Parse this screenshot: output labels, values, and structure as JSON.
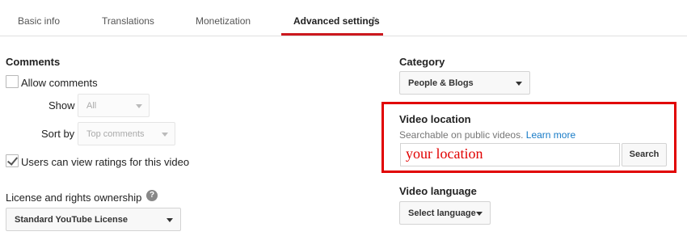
{
  "tabs": {
    "basic_info": "Basic info",
    "translations": "Translations",
    "monetization": "Monetization",
    "advanced_settings": "Advanced settings"
  },
  "comments": {
    "title": "Comments",
    "allow_comments_label": "Allow comments",
    "allow_comments_checked": false,
    "show_label": "Show",
    "show_value": "All",
    "sort_by_label": "Sort by",
    "sort_by_value": "Top comments",
    "ratings_label": "Users can view ratings for this video",
    "ratings_checked": true
  },
  "license": {
    "title": "License and rights ownership",
    "help_glyph": "?",
    "value": "Standard YouTube License"
  },
  "category": {
    "title": "Category",
    "value": "People & Blogs"
  },
  "video_location": {
    "title": "Video location",
    "description": "Searchable on public videos.",
    "learn_more": "Learn more",
    "input_value": "your location",
    "search_label": "Search"
  },
  "video_language": {
    "title": "Video language",
    "value": "Select language"
  },
  "colors": {
    "active_tab_underline": "#cc181e",
    "highlight_box": "#e10000",
    "link": "#167ac6"
  }
}
